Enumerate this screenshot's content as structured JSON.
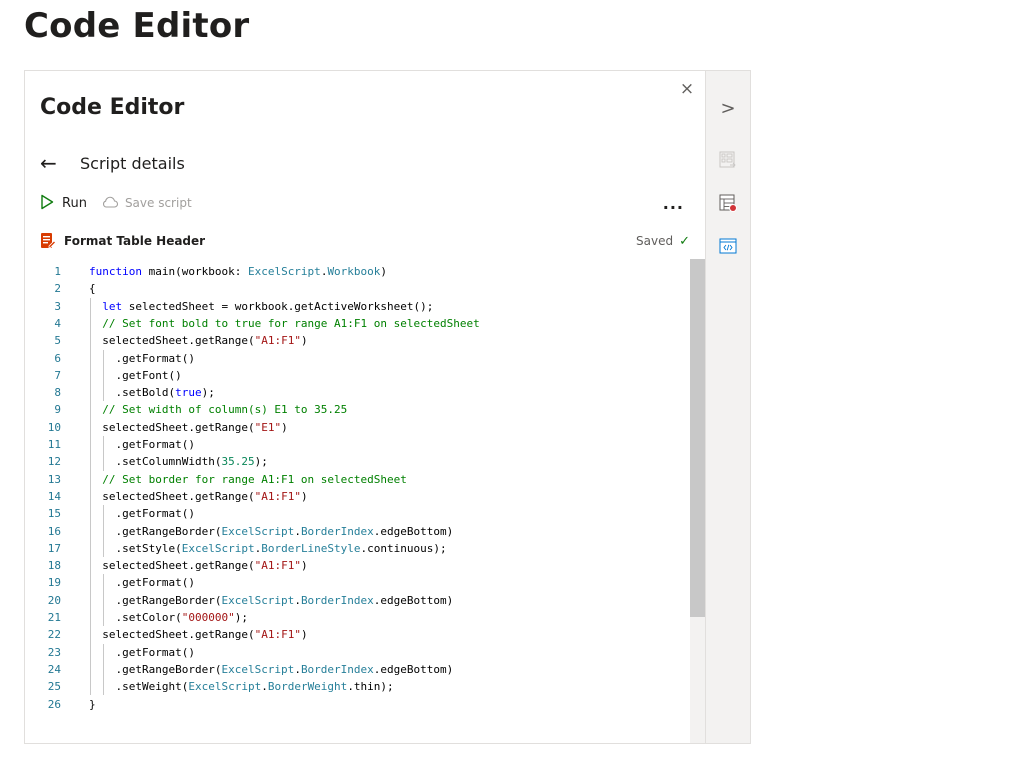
{
  "page": {
    "title": "Code Editor"
  },
  "panel": {
    "title": "Code Editor",
    "close_icon": "×",
    "back_icon": "←",
    "nav_label": "Script details",
    "toolbar": {
      "run_label": "Run",
      "save_label": "Save script",
      "more_label": "..."
    },
    "script": {
      "name": "Format Table Header",
      "status": "Saved",
      "status_check": "✓"
    }
  },
  "sidebar": {
    "expand_icon": ">"
  },
  "code": {
    "lines": [
      {
        "n": "1",
        "segs": [
          [
            "kw",
            "function"
          ],
          [
            "p",
            " main(workbook: "
          ],
          [
            "type",
            "ExcelScript"
          ],
          [
            "p",
            "."
          ],
          [
            "type",
            "Workbook"
          ],
          [
            "p",
            ")"
          ]
        ]
      },
      {
        "n": "2",
        "segs": [
          [
            "p",
            "{"
          ]
        ]
      },
      {
        "n": "3",
        "segs": [
          [
            "p",
            "  "
          ],
          [
            "kw",
            "let"
          ],
          [
            "p",
            " selectedSheet = workbook.getActiveWorksheet();"
          ]
        ]
      },
      {
        "n": "4",
        "segs": [
          [
            "p",
            "  "
          ],
          [
            "cmt",
            "// Set font bold to true for range A1:F1 on selectedSheet"
          ]
        ]
      },
      {
        "n": "5",
        "segs": [
          [
            "p",
            "  selectedSheet.getRange("
          ],
          [
            "str",
            "\"A1:F1\""
          ],
          [
            "p",
            ")"
          ]
        ]
      },
      {
        "n": "6",
        "segs": [
          [
            "p",
            "    .getFormat()"
          ]
        ]
      },
      {
        "n": "7",
        "segs": [
          [
            "p",
            "    .getFont()"
          ]
        ]
      },
      {
        "n": "8",
        "segs": [
          [
            "p",
            "    .setBold("
          ],
          [
            "kw",
            "true"
          ],
          [
            "p",
            ");"
          ]
        ]
      },
      {
        "n": "9",
        "segs": [
          [
            "p",
            "  "
          ],
          [
            "cmt",
            "// Set width of column(s) E1 to 35.25"
          ]
        ]
      },
      {
        "n": "10",
        "segs": [
          [
            "p",
            "  selectedSheet.getRange("
          ],
          [
            "str",
            "\"E1\""
          ],
          [
            "p",
            ")"
          ]
        ]
      },
      {
        "n": "11",
        "segs": [
          [
            "p",
            "    .getFormat()"
          ]
        ]
      },
      {
        "n": "12",
        "segs": [
          [
            "p",
            "    .setColumnWidth("
          ],
          [
            "num",
            "35.25"
          ],
          [
            "p",
            ");"
          ]
        ]
      },
      {
        "n": "13",
        "segs": [
          [
            "p",
            "  "
          ],
          [
            "cmt",
            "// Set border for range A1:F1 on selectedSheet"
          ]
        ]
      },
      {
        "n": "14",
        "segs": [
          [
            "p",
            "  selectedSheet.getRange("
          ],
          [
            "str",
            "\"A1:F1\""
          ],
          [
            "p",
            ")"
          ]
        ]
      },
      {
        "n": "15",
        "segs": [
          [
            "p",
            "    .getFormat()"
          ]
        ]
      },
      {
        "n": "16",
        "segs": [
          [
            "p",
            "    .getRangeBorder("
          ],
          [
            "type",
            "ExcelScript"
          ],
          [
            "p",
            "."
          ],
          [
            "type",
            "BorderIndex"
          ],
          [
            "p",
            ".edgeBottom)"
          ]
        ]
      },
      {
        "n": "17",
        "segs": [
          [
            "p",
            "    .setStyle("
          ],
          [
            "type",
            "ExcelScript"
          ],
          [
            "p",
            "."
          ],
          [
            "type",
            "BorderLineStyle"
          ],
          [
            "p",
            ".continuous);"
          ]
        ]
      },
      {
        "n": "18",
        "segs": [
          [
            "p",
            "  selectedSheet.getRange("
          ],
          [
            "str",
            "\"A1:F1\""
          ],
          [
            "p",
            ")"
          ]
        ]
      },
      {
        "n": "19",
        "segs": [
          [
            "p",
            "    .getFormat()"
          ]
        ]
      },
      {
        "n": "20",
        "segs": [
          [
            "p",
            "    .getRangeBorder("
          ],
          [
            "type",
            "ExcelScript"
          ],
          [
            "p",
            "."
          ],
          [
            "type",
            "BorderIndex"
          ],
          [
            "p",
            ".edgeBottom)"
          ]
        ]
      },
      {
        "n": "21",
        "segs": [
          [
            "p",
            "    .setColor("
          ],
          [
            "str",
            "\"000000\""
          ],
          [
            "p",
            ");"
          ]
        ]
      },
      {
        "n": "22",
        "segs": [
          [
            "p",
            "  selectedSheet.getRange("
          ],
          [
            "str",
            "\"A1:F1\""
          ],
          [
            "p",
            ")"
          ]
        ]
      },
      {
        "n": "23",
        "segs": [
          [
            "p",
            "    .getFormat()"
          ]
        ]
      },
      {
        "n": "24",
        "segs": [
          [
            "p",
            "    .getRangeBorder("
          ],
          [
            "type",
            "ExcelScript"
          ],
          [
            "p",
            "."
          ],
          [
            "type",
            "BorderIndex"
          ],
          [
            "p",
            ".edgeBottom)"
          ]
        ]
      },
      {
        "n": "25",
        "segs": [
          [
            "p",
            "    .setWeight("
          ],
          [
            "type",
            "ExcelScript"
          ],
          [
            "p",
            "."
          ],
          [
            "type",
            "BorderWeight"
          ],
          [
            "p",
            ".thin);"
          ]
        ]
      },
      {
        "n": "26",
        "segs": [
          [
            "p",
            "}"
          ]
        ]
      }
    ]
  },
  "colors": {
    "run": "#107c10",
    "saved": "#107c10",
    "keyword": "#0000ff",
    "type": "#267f99",
    "string": "#a31515",
    "comment": "#008000",
    "number": "#098658",
    "line_number": "#237893"
  }
}
